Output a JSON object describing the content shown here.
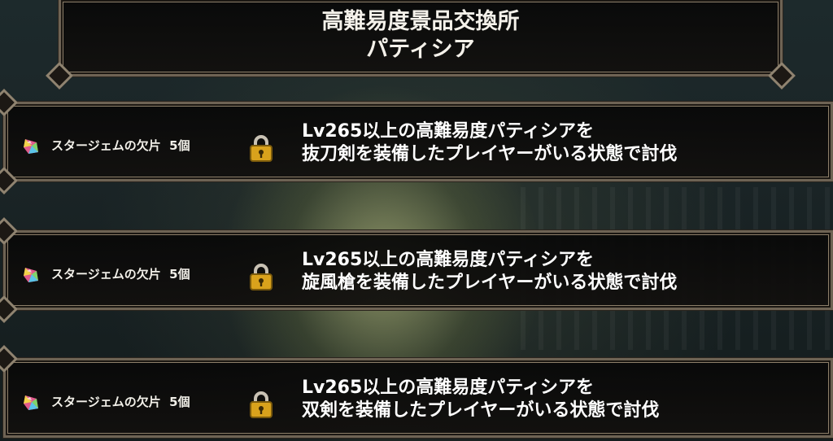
{
  "header": {
    "title_line1": "高難易度景品交換所",
    "title_line2": "パティシア"
  },
  "rewards": [
    {
      "item_icon": "star-gem-icon",
      "item_label": "スタージェムの欠片",
      "quantity": "5個",
      "status_icon": "lock-icon",
      "condition_line1": "Lv265以上の高難易度パティシアを",
      "condition_line2": "抜刀剣を装備したプレイヤーがいる状態で討伐"
    },
    {
      "item_icon": "star-gem-icon",
      "item_label": "スタージェムの欠片",
      "quantity": "5個",
      "status_icon": "lock-icon",
      "condition_line1": "Lv265以上の高難易度パティシアを",
      "condition_line2": "旋風槍を装備したプレイヤーがいる状態で討伐"
    },
    {
      "item_icon": "star-gem-icon",
      "item_label": "スタージェムの欠片",
      "quantity": "5個",
      "status_icon": "lock-icon",
      "condition_line1": "Lv265以上の高難易度パティシアを",
      "condition_line2": "双剣を装備したプレイヤーがいる状態で討伐"
    }
  ],
  "colors": {
    "frame": "#8f8370",
    "panel": "#0c0b0a",
    "lock_gold": "#d9a21c"
  }
}
